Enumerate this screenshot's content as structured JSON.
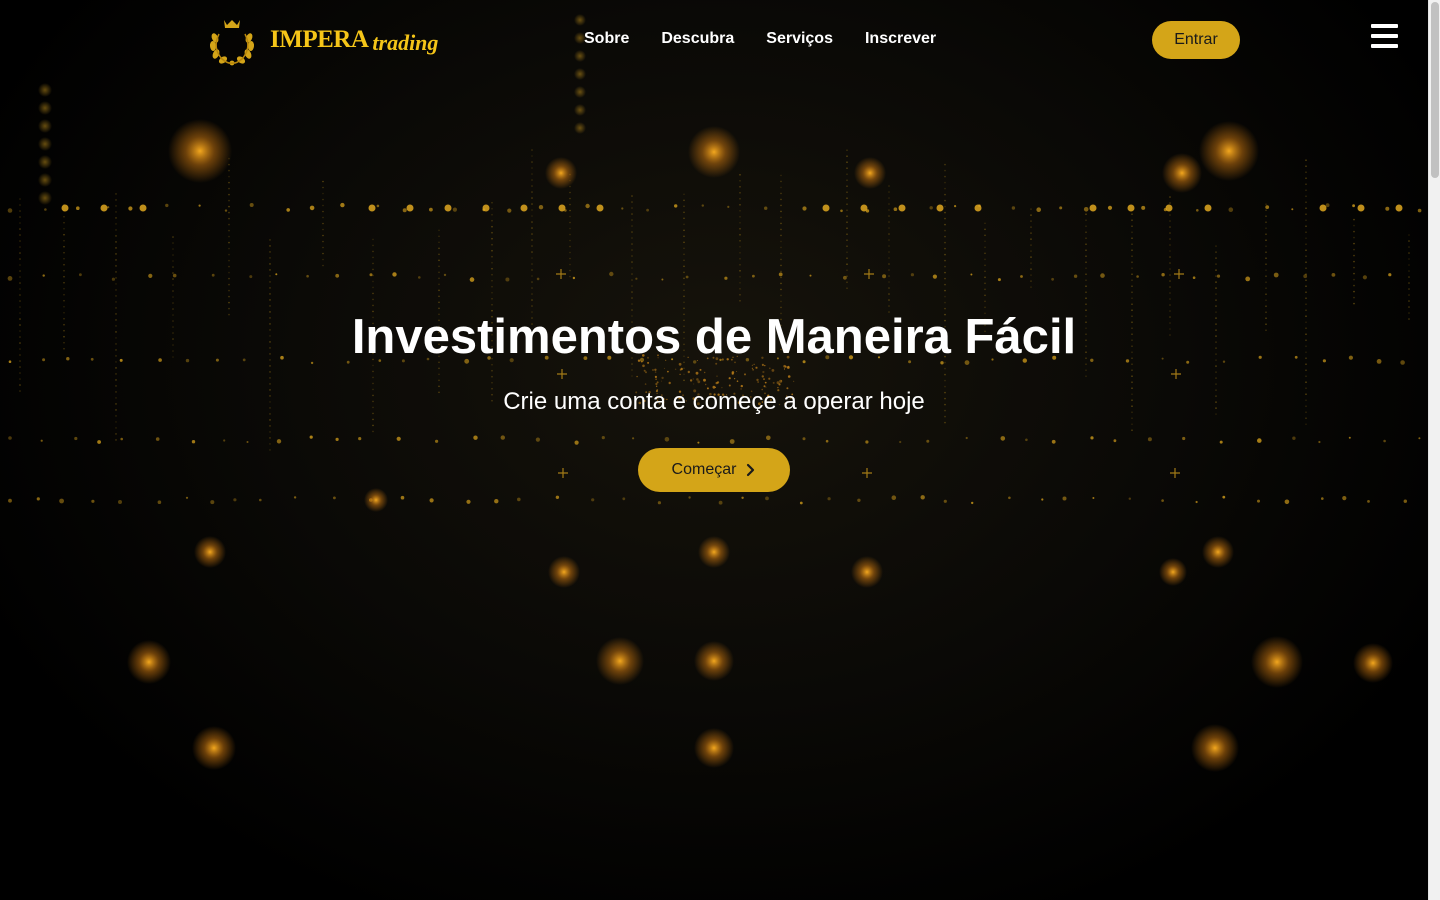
{
  "brand": {
    "name": "IMPERA",
    "sub": "trading",
    "gold": "#f5c518"
  },
  "nav": {
    "links": [
      "Sobre",
      "Descubra",
      "Serviços",
      "Inscrever"
    ],
    "login_label": "Entrar",
    "menu_icon": "hamburger-icon"
  },
  "hero": {
    "title": "Investimentos de Maneira Fácil",
    "subtitle": "Crie uma conta e começe a operar hoje",
    "cta_label": "Começar",
    "cta_icon": "chevron-right-icon"
  },
  "colors": {
    "accent": "#d4a518",
    "background": "#000000",
    "text": "#ffffff"
  }
}
